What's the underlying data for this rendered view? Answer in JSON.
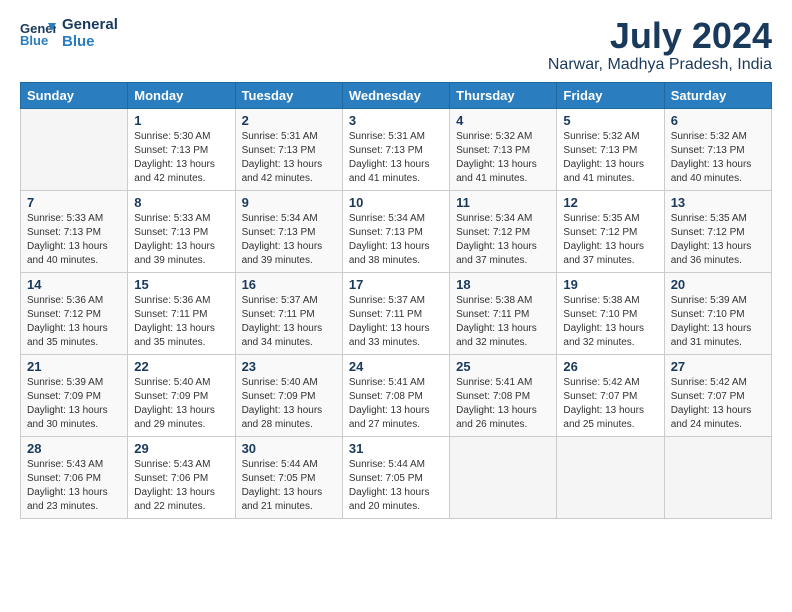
{
  "header": {
    "logo_line1": "General",
    "logo_line2": "Blue",
    "month_year": "July 2024",
    "location": "Narwar, Madhya Pradesh, India"
  },
  "days_of_week": [
    "Sunday",
    "Monday",
    "Tuesday",
    "Wednesday",
    "Thursday",
    "Friday",
    "Saturday"
  ],
  "weeks": [
    [
      {
        "day": "",
        "sunrise": "",
        "sunset": "",
        "daylight": ""
      },
      {
        "day": "1",
        "sunrise": "Sunrise: 5:30 AM",
        "sunset": "Sunset: 7:13 PM",
        "daylight": "Daylight: 13 hours and 42 minutes."
      },
      {
        "day": "2",
        "sunrise": "Sunrise: 5:31 AM",
        "sunset": "Sunset: 7:13 PM",
        "daylight": "Daylight: 13 hours and 42 minutes."
      },
      {
        "day": "3",
        "sunrise": "Sunrise: 5:31 AM",
        "sunset": "Sunset: 7:13 PM",
        "daylight": "Daylight: 13 hours and 41 minutes."
      },
      {
        "day": "4",
        "sunrise": "Sunrise: 5:32 AM",
        "sunset": "Sunset: 7:13 PM",
        "daylight": "Daylight: 13 hours and 41 minutes."
      },
      {
        "day": "5",
        "sunrise": "Sunrise: 5:32 AM",
        "sunset": "Sunset: 7:13 PM",
        "daylight": "Daylight: 13 hours and 41 minutes."
      },
      {
        "day": "6",
        "sunrise": "Sunrise: 5:32 AM",
        "sunset": "Sunset: 7:13 PM",
        "daylight": "Daylight: 13 hours and 40 minutes."
      }
    ],
    [
      {
        "day": "7",
        "sunrise": "Sunrise: 5:33 AM",
        "sunset": "Sunset: 7:13 PM",
        "daylight": "Daylight: 13 hours and 40 minutes."
      },
      {
        "day": "8",
        "sunrise": "Sunrise: 5:33 AM",
        "sunset": "Sunset: 7:13 PM",
        "daylight": "Daylight: 13 hours and 39 minutes."
      },
      {
        "day": "9",
        "sunrise": "Sunrise: 5:34 AM",
        "sunset": "Sunset: 7:13 PM",
        "daylight": "Daylight: 13 hours and 39 minutes."
      },
      {
        "day": "10",
        "sunrise": "Sunrise: 5:34 AM",
        "sunset": "Sunset: 7:13 PM",
        "daylight": "Daylight: 13 hours and 38 minutes."
      },
      {
        "day": "11",
        "sunrise": "Sunrise: 5:34 AM",
        "sunset": "Sunset: 7:12 PM",
        "daylight": "Daylight: 13 hours and 37 minutes."
      },
      {
        "day": "12",
        "sunrise": "Sunrise: 5:35 AM",
        "sunset": "Sunset: 7:12 PM",
        "daylight": "Daylight: 13 hours and 37 minutes."
      },
      {
        "day": "13",
        "sunrise": "Sunrise: 5:35 AM",
        "sunset": "Sunset: 7:12 PM",
        "daylight": "Daylight: 13 hours and 36 minutes."
      }
    ],
    [
      {
        "day": "14",
        "sunrise": "Sunrise: 5:36 AM",
        "sunset": "Sunset: 7:12 PM",
        "daylight": "Daylight: 13 hours and 35 minutes."
      },
      {
        "day": "15",
        "sunrise": "Sunrise: 5:36 AM",
        "sunset": "Sunset: 7:11 PM",
        "daylight": "Daylight: 13 hours and 35 minutes."
      },
      {
        "day": "16",
        "sunrise": "Sunrise: 5:37 AM",
        "sunset": "Sunset: 7:11 PM",
        "daylight": "Daylight: 13 hours and 34 minutes."
      },
      {
        "day": "17",
        "sunrise": "Sunrise: 5:37 AM",
        "sunset": "Sunset: 7:11 PM",
        "daylight": "Daylight: 13 hours and 33 minutes."
      },
      {
        "day": "18",
        "sunrise": "Sunrise: 5:38 AM",
        "sunset": "Sunset: 7:11 PM",
        "daylight": "Daylight: 13 hours and 32 minutes."
      },
      {
        "day": "19",
        "sunrise": "Sunrise: 5:38 AM",
        "sunset": "Sunset: 7:10 PM",
        "daylight": "Daylight: 13 hours and 32 minutes."
      },
      {
        "day": "20",
        "sunrise": "Sunrise: 5:39 AM",
        "sunset": "Sunset: 7:10 PM",
        "daylight": "Daylight: 13 hours and 31 minutes."
      }
    ],
    [
      {
        "day": "21",
        "sunrise": "Sunrise: 5:39 AM",
        "sunset": "Sunset: 7:09 PM",
        "daylight": "Daylight: 13 hours and 30 minutes."
      },
      {
        "day": "22",
        "sunrise": "Sunrise: 5:40 AM",
        "sunset": "Sunset: 7:09 PM",
        "daylight": "Daylight: 13 hours and 29 minutes."
      },
      {
        "day": "23",
        "sunrise": "Sunrise: 5:40 AM",
        "sunset": "Sunset: 7:09 PM",
        "daylight": "Daylight: 13 hours and 28 minutes."
      },
      {
        "day": "24",
        "sunrise": "Sunrise: 5:41 AM",
        "sunset": "Sunset: 7:08 PM",
        "daylight": "Daylight: 13 hours and 27 minutes."
      },
      {
        "day": "25",
        "sunrise": "Sunrise: 5:41 AM",
        "sunset": "Sunset: 7:08 PM",
        "daylight": "Daylight: 13 hours and 26 minutes."
      },
      {
        "day": "26",
        "sunrise": "Sunrise: 5:42 AM",
        "sunset": "Sunset: 7:07 PM",
        "daylight": "Daylight: 13 hours and 25 minutes."
      },
      {
        "day": "27",
        "sunrise": "Sunrise: 5:42 AM",
        "sunset": "Sunset: 7:07 PM",
        "daylight": "Daylight: 13 hours and 24 minutes."
      }
    ],
    [
      {
        "day": "28",
        "sunrise": "Sunrise: 5:43 AM",
        "sunset": "Sunset: 7:06 PM",
        "daylight": "Daylight: 13 hours and 23 minutes."
      },
      {
        "day": "29",
        "sunrise": "Sunrise: 5:43 AM",
        "sunset": "Sunset: 7:06 PM",
        "daylight": "Daylight: 13 hours and 22 minutes."
      },
      {
        "day": "30",
        "sunrise": "Sunrise: 5:44 AM",
        "sunset": "Sunset: 7:05 PM",
        "daylight": "Daylight: 13 hours and 21 minutes."
      },
      {
        "day": "31",
        "sunrise": "Sunrise: 5:44 AM",
        "sunset": "Sunset: 7:05 PM",
        "daylight": "Daylight: 13 hours and 20 minutes."
      },
      {
        "day": "",
        "sunrise": "",
        "sunset": "",
        "daylight": ""
      },
      {
        "day": "",
        "sunrise": "",
        "sunset": "",
        "daylight": ""
      },
      {
        "day": "",
        "sunrise": "",
        "sunset": "",
        "daylight": ""
      }
    ]
  ]
}
